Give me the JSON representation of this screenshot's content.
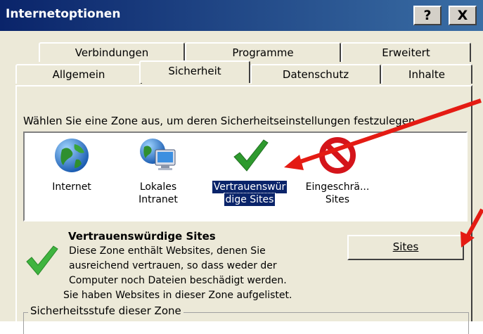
{
  "window": {
    "title": "Internetoptionen",
    "help_label": "?",
    "close_label": "X"
  },
  "tabs_back": [
    {
      "label": "Verbindungen"
    },
    {
      "label": "Programme"
    },
    {
      "label": "Erweitert"
    }
  ],
  "tabs_front": [
    {
      "label": "Allgemein"
    },
    {
      "label": "Sicherheit",
      "active": true
    },
    {
      "label": "Datenschutz"
    },
    {
      "label": "Inhalte"
    }
  ],
  "security": {
    "intro": "Wählen Sie eine Zone aus, um deren Sicherheitseinstellungen festzulegen.",
    "zones": [
      {
        "line1": "Internet",
        "line2": "",
        "icon": "globe-icon"
      },
      {
        "line1": "Lokales",
        "line2": "Intranet",
        "icon": "intranet-icon"
      },
      {
        "line1": "Vertrauenswür",
        "line2": "dige Sites",
        "icon": "checkmark-icon",
        "selected": true
      },
      {
        "line1": "Eingeschrä...",
        "line2": "Sites",
        "icon": "no-entry-icon"
      }
    ],
    "zone_title": "Vertrauenswürdige Sites",
    "zone_desc": [
      "Diese Zone enthält Websites, denen Sie",
      "ausreichend vertrauen, so dass weder der",
      "Computer noch Dateien beschädigt werden.",
      "Sie haben Websites in dieser Zone aufgelistet."
    ],
    "sites_button": "Sites",
    "level_group_label": "Sicherheitsstufe dieser Zone"
  },
  "colors": {
    "titlebar": "#0a246a",
    "dialog_bg": "#ece9d8",
    "annotation_arrow": "#e41b13",
    "selection": "#0a246a"
  }
}
